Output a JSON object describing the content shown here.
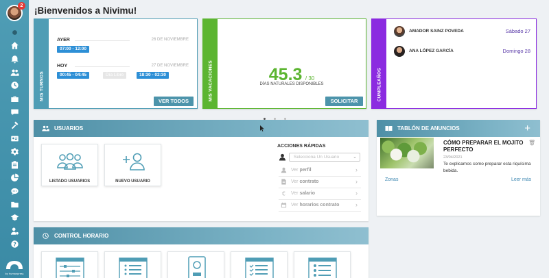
{
  "header": {
    "title": "¡Bienvenidos a Nivimu!"
  },
  "user": {
    "notifications": "2"
  },
  "sidebar": {
    "icons": [
      "dot-icon",
      "home-icon",
      "bell-icon",
      "users-icon",
      "clock-icon",
      "briefcase-icon",
      "chat-bubble-icon",
      "tools-icon",
      "id-card-icon",
      "gear-icon",
      "clipboard-icon",
      "pie-chart-icon",
      "messages-icon",
      "folder-icon",
      "graduation-cap-icon",
      "user-gear-icon",
      "help-icon"
    ],
    "logo_text": "by humanpress"
  },
  "turnos": {
    "label": "MIS TURNOS",
    "days": [
      {
        "name": "AYER",
        "date": "26 DE NOVIEMBRE",
        "slots": [
          "07:00 - 12:00"
        ]
      },
      {
        "name": "HOY",
        "date": "27 DE NOVIEMBRE",
        "slots": [
          "00:45 - 04:45",
          "Día Libre",
          "18:30 - 02:30"
        ]
      }
    ],
    "button": "VER TODOS"
  },
  "vacaciones": {
    "label": "MIS VACACIONES",
    "days": "45.3",
    "total": "/ 30",
    "caption": "DÍAS NATURALES DISPONIBLES",
    "button": "SOLICITAR"
  },
  "cumpleanos": {
    "label": "CUMPLEAÑOS",
    "people": [
      {
        "name": "AMADOR SAINZ POVEDA",
        "day": "Sábado  27"
      },
      {
        "name": "ANA LÓPEZ GARCÍA",
        "day": "Domingo  28"
      }
    ]
  },
  "usuarios": {
    "title": "USUARIOS",
    "tiles": [
      "LISTADO USUARIOS",
      "NUEVO USUARIO"
    ],
    "quick_actions": {
      "title": "ACCIONES RÁPIDAS",
      "placeholder": "Selecciona Un Usuario",
      "items": [
        {
          "prefix": "Ver ",
          "bold": "perfil"
        },
        {
          "prefix": "Ver ",
          "bold": "contrato"
        },
        {
          "prefix": "Ver ",
          "bold": "salario"
        },
        {
          "prefix": "Ver ",
          "bold": "horarios contrato"
        }
      ]
    }
  },
  "tablon": {
    "title": "TABLÓN DE ANUNCIOS",
    "news": {
      "title": "CÓMO PREPARAR EL MOJITO PERFECTO",
      "date": "23/04/2021",
      "body": "Te explicamos como preparar esta riquísima bebida.",
      "category": "Zonas",
      "more": "Leer más"
    }
  },
  "control": {
    "title": "CONTROL HORARIO"
  },
  "colors": {
    "turnos": "#4f9db5",
    "vacaciones": "#5cb531",
    "cumple": "#8b2be0",
    "chip": "#2d8fd6",
    "button": "#4d94ab"
  }
}
